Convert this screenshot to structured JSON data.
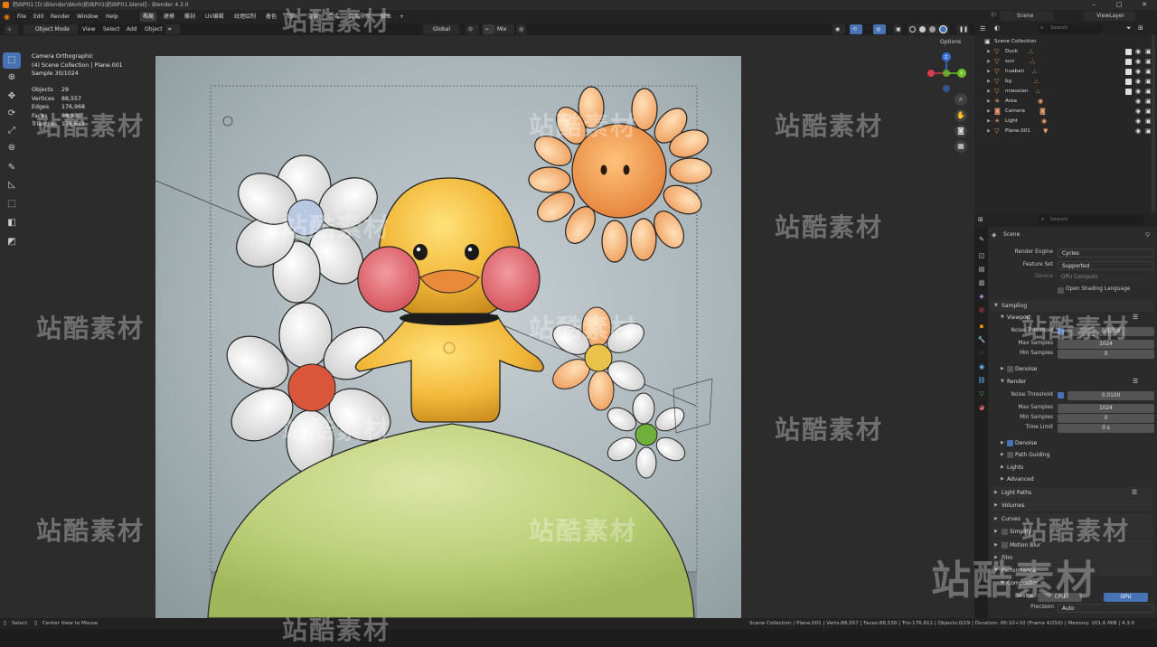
{
  "window": {
    "title": "奶凶P01 [D:\\Blender\\Work\\奶凶P01\\奶凶P01.blend] - Blender 4.3.0",
    "controls": [
      "–",
      "□",
      "✕"
    ]
  },
  "menubar": {
    "items": [
      "File",
      "Edit",
      "Render",
      "Window",
      "Help"
    ],
    "workspaces": [
      "布局",
      "建模",
      "雕刻",
      "UV编辑",
      "纹理绘制",
      "着色",
      "动画",
      "渲染",
      "合成",
      "几何节点",
      "脚本"
    ],
    "active_workspace": 0,
    "scene_label": "Scene",
    "view_layer_label": "ViewLayer"
  },
  "viewport_header": {
    "mode": "Object Mode",
    "menus": [
      "View",
      "Select",
      "Add",
      "Object"
    ],
    "transform_orientation": "Global",
    "snap_label": "Mix",
    "options_label": "Options"
  },
  "viewport": {
    "overlay_lines": [
      "Camera Orthographic",
      "(4) Scene Collection | Plane.001",
      "Sample 30/1024"
    ],
    "stats": [
      {
        "label": "Objects",
        "value": "29"
      },
      {
        "label": "Vertices",
        "value": "88,557"
      },
      {
        "label": "Edges",
        "value": "176,968"
      },
      {
        "label": "Faces",
        "value": "88,530"
      },
      {
        "label": "Triangles",
        "value": "176,612"
      }
    ],
    "nav_axes": {
      "x": "X",
      "y": "Y",
      "z": "Z"
    }
  },
  "outliner": {
    "search_placeholder": "Search",
    "root": "Scene Collection",
    "items": [
      {
        "name": "Duck",
        "icon_color": "#e9924b",
        "kind": "collection"
      },
      {
        "name": "sun",
        "icon_color": "#e9924b",
        "kind": "collection"
      },
      {
        "name": "huaban",
        "icon_color": "#e9924b",
        "kind": "collection"
      },
      {
        "name": "bg",
        "icon_color": "#e9924b",
        "kind": "collection"
      },
      {
        "name": "miaoxian",
        "icon_color": "#e9924b",
        "kind": "collection"
      },
      {
        "name": "Area",
        "icon_color": "#f0a070",
        "kind": "light"
      },
      {
        "name": "Camera",
        "icon_color": "#f0a070",
        "kind": "camera"
      },
      {
        "name": "Light",
        "icon_color": "#f0a070",
        "kind": "light"
      },
      {
        "name": "Plane.001",
        "icon_color": "#f0a070",
        "kind": "mesh"
      }
    ]
  },
  "properties": {
    "search_placeholder": "Search",
    "context": "Scene",
    "render_engine_label": "Render Engine",
    "render_engine": "Cycles",
    "feature_set_label": "Feature Set",
    "feature_set": "Supported",
    "device_label": "Device",
    "device": "GPU Compute",
    "osl_label": "Open Shading Language",
    "sampling": {
      "title": "Sampling",
      "viewport": {
        "title": "Viewport",
        "noise_threshold_label": "Noise Threshold",
        "noise_threshold": "0.1000",
        "max_samples_label": "Max Samples",
        "max_samples": "1024",
        "min_samples_label": "Min Samples",
        "min_samples": "0",
        "denoise_label": "Denoise"
      },
      "render": {
        "title": "Render",
        "noise_threshold_label": "Noise Threshold",
        "noise_threshold": "0.0100",
        "max_samples_label": "Max Samples",
        "max_samples": "1024",
        "min_samples_label": "Min Samples",
        "min_samples": "0",
        "time_limit_label": "Time Limit",
        "time_limit": "0 s",
        "denoise_label": "Denoise"
      },
      "path_guiding_label": "Path Guiding",
      "lights_label": "Lights",
      "advanced_label": "Advanced"
    },
    "panels": [
      "Light Paths",
      "Volumes",
      "Curves",
      "Simplify",
      "Motion Blur",
      "Film",
      "Performance",
      "Compositor"
    ],
    "compositor_device_label": "Device",
    "compositor_devices": [
      "CPU",
      "GPU"
    ],
    "compositor_active_device": "GPU",
    "precision_label": "Precision",
    "precision": "Auto"
  },
  "statusbar": {
    "left_items": [
      "Select",
      "Center View to Mouse"
    ],
    "right_text": "Scene Collection | Plane.001 | Verts:88,557 | Faces:88,530 | Tris:176,612 | Objects:0/29 | Duration: 00:10+10 (Frame 4/250) | Memory: 201.6 MiB | 4.3.0"
  },
  "watermark": {
    "text": "站酷素材"
  },
  "colors": {
    "accent": "#4772b3",
    "viewport_bg": "#2c2c2c",
    "panel_bg": "#2b2b2b",
    "duck": "#f2c14a",
    "hill": "#c9d98a"
  }
}
